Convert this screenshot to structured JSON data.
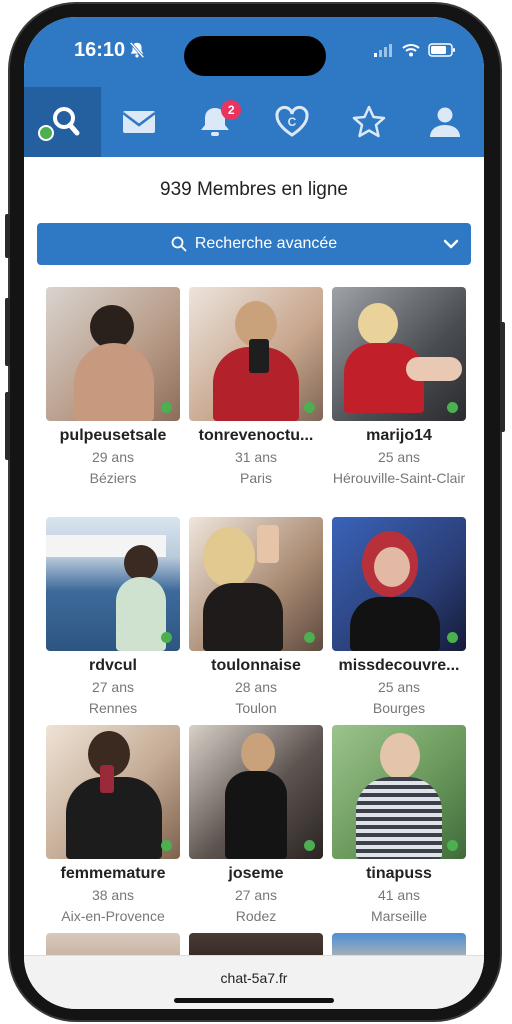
{
  "status": {
    "time": "16:10"
  },
  "nav": {
    "items": [
      {
        "name": "search",
        "icon": "search-icon",
        "active": true
      },
      {
        "name": "messages",
        "icon": "envelope-icon"
      },
      {
        "name": "notifications",
        "icon": "bell-icon",
        "badge": "2"
      },
      {
        "name": "matches",
        "icon": "heart-icon"
      },
      {
        "name": "favorites",
        "icon": "star-icon"
      },
      {
        "name": "profile",
        "icon": "user-icon"
      }
    ]
  },
  "header": {
    "online_count": "939 Membres en ligne"
  },
  "search": {
    "label": "Recherche avancée"
  },
  "members": [
    {
      "username": "pulpeusetsale",
      "age": "29 ans",
      "city": "Béziers",
      "color": "#b79a86",
      "online": true
    },
    {
      "username": "tonrevenoctu...",
      "age": "31 ans",
      "city": "Paris",
      "color": "#c7a58c",
      "online": true
    },
    {
      "username": "marijo14",
      "age": "25 ans",
      "city": "Hérouville-Saint-Clair",
      "color": "#6f6f73",
      "online": true
    },
    {
      "username": "rdvcul",
      "age": "27 ans",
      "city": "Rennes",
      "color": "#6a90b8",
      "online": true
    },
    {
      "username": "toulonnaise",
      "age": "28 ans",
      "city": "Toulon",
      "color": "#a88a72",
      "online": true
    },
    {
      "username": "missdecouvre...",
      "age": "25 ans",
      "city": "Bourges",
      "color": "#2b3f78",
      "online": true
    },
    {
      "username": "femmemature",
      "age": "38 ans",
      "city": "Aix-en-Provence",
      "color": "#8a6d55",
      "online": true
    },
    {
      "username": "joseme",
      "age": "27 ans",
      "city": "Rodez",
      "color": "#5d5450",
      "online": true
    },
    {
      "username": "tinapuss",
      "age": "41 ans",
      "city": "Marseille",
      "color": "#6b9a5c",
      "online": true
    }
  ],
  "browser": {
    "url": "chat-5a7.fr"
  },
  "colors": {
    "brand": "#2f78c4",
    "online": "#4caf50",
    "badge": "#e8345f"
  }
}
